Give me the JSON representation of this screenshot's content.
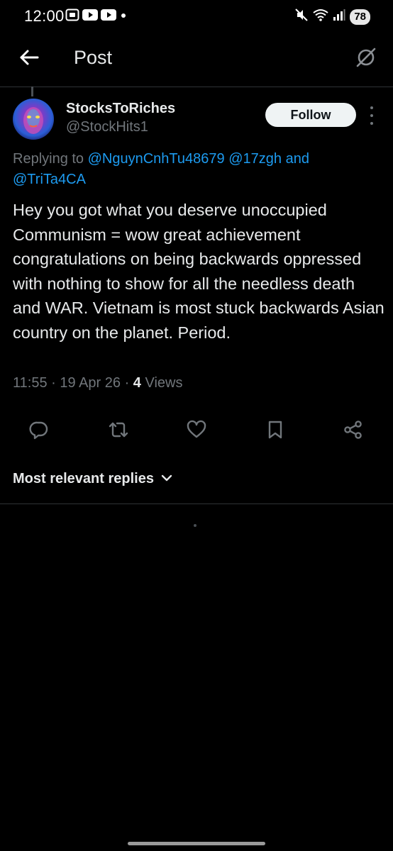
{
  "status_bar": {
    "time": "12:00",
    "battery": "78",
    "icons": [
      "screenshot-icon",
      "youtube-icon",
      "youtube-icon",
      "dot-icon",
      "mute-icon",
      "wifi-icon",
      "signal-icon"
    ]
  },
  "header": {
    "title": "Post",
    "back_icon": "arrow-left-icon",
    "grok_icon": "grok-icon"
  },
  "post": {
    "author": {
      "display_name": "StocksToRiches",
      "handle": "@StockHits1"
    },
    "follow_label": "Follow",
    "replying_prefix": "Replying to",
    "mentions": [
      "@NguynCnhTu48679",
      "@17zgh",
      "@TriTa4CA"
    ],
    "replying_and": "and",
    "body": "Hey you got what you deserve unoccupied Communism = wow great achievement congratulations on being backwards oppressed with nothing to show for all the needless death and WAR. Vietnam is most stuck backwards Asian country on the planet. Period.",
    "time": "11:55",
    "date": "19 Apr 26",
    "separator": "·",
    "views_count": "4",
    "views_label": "Views"
  },
  "actions": [
    "reply-icon",
    "repost-icon",
    "like-icon",
    "bookmark-icon",
    "share-icon"
  ],
  "replies": {
    "sort_label": "Most relevant replies"
  },
  "colors": {
    "background": "#000000",
    "text": "#e7e9ea",
    "muted": "#71767b",
    "accent": "#1d9bf0",
    "border": "#2f3336"
  }
}
